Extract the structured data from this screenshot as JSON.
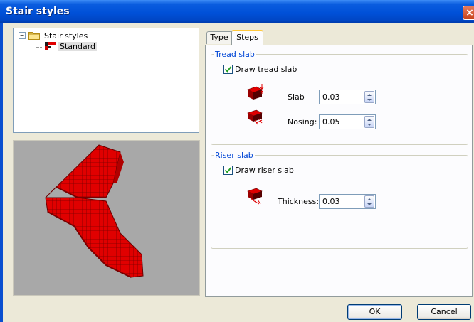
{
  "window": {
    "title": "Stair styles",
    "close_glyph": "×"
  },
  "tree": {
    "root_label": "Stair styles",
    "root_expander": "−",
    "child_label": "Standard"
  },
  "tabs": [
    {
      "label": "Type",
      "active": false
    },
    {
      "label": "Steps",
      "active": true
    }
  ],
  "tread_slab": {
    "legend": "Tread slab",
    "checkbox_label": "Draw tread slab",
    "checked": true,
    "slab_label": "Slab",
    "slab_value": "0.03",
    "nosing_label": "Nosing:",
    "nosing_value": "0.05",
    "slab_icon": "tread-slab-icon",
    "nosing_icon": "nosing-icon"
  },
  "riser_slab": {
    "legend": "Riser slab",
    "checkbox_label": "Draw riser slab",
    "checked": true,
    "thickness_label": "Thickness:",
    "thickness_value": "0.03",
    "thickness_icon": "riser-thickness-icon"
  },
  "buttons": {
    "ok": "OK",
    "cancel": "Cancel"
  },
  "colors": {
    "titlebar": "#0050d8",
    "group_legend": "#0046d5",
    "stair_preview": "#e00000",
    "preview_background": "#a8a8a8"
  }
}
